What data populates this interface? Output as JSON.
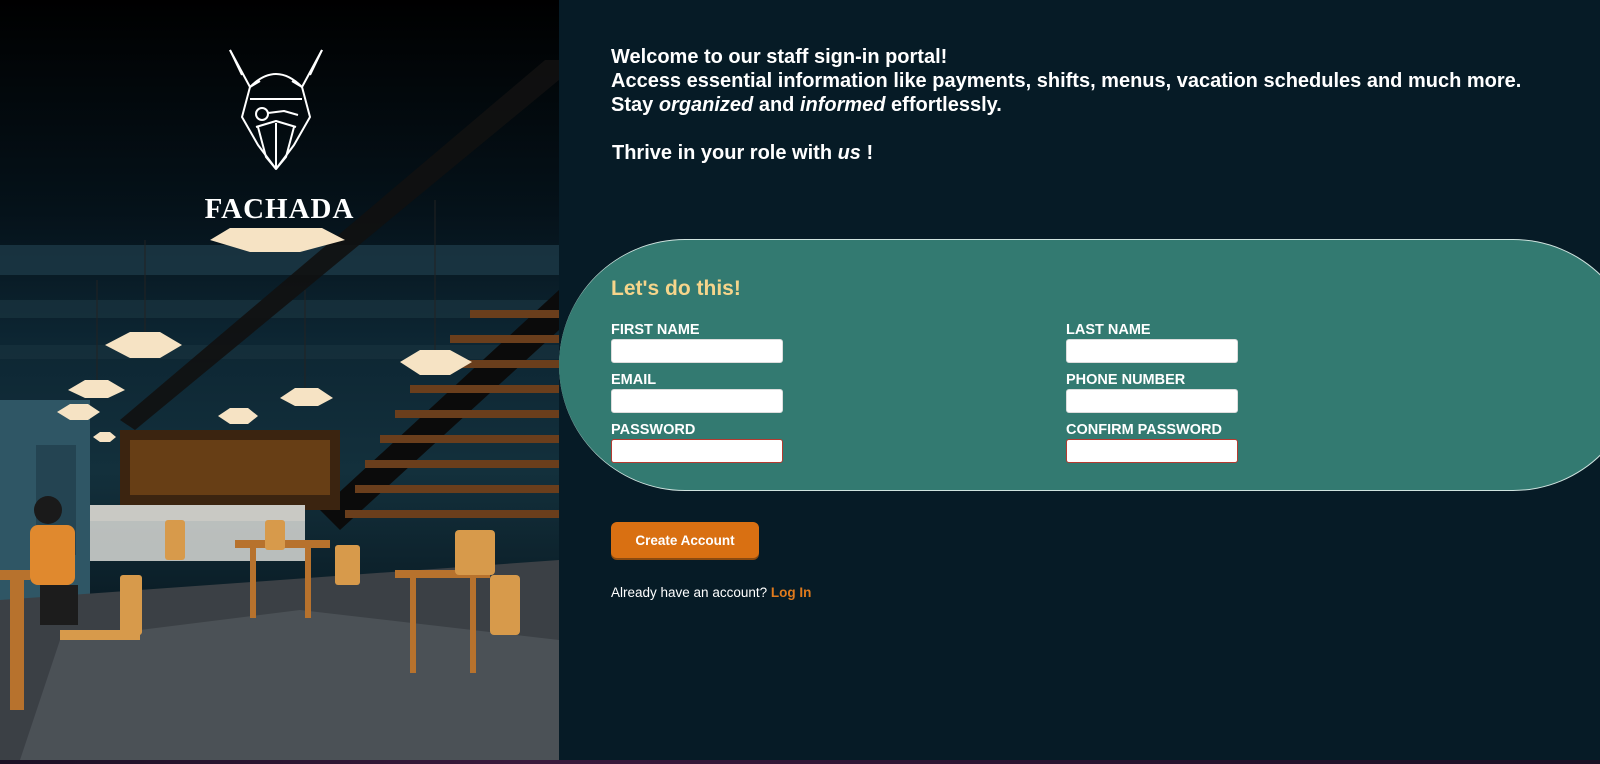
{
  "brand": {
    "name": "FACHADA"
  },
  "intro": {
    "line1": "Welcome to our staff sign-in portal!",
    "line2": "Access essential information like payments, shifts, menus, vacation schedules and much more.",
    "line3_a": "Stay ",
    "line3_b": "organized",
    "line3_c": " and ",
    "line3_d": "informed",
    "line3_e": " effortlessly.",
    "thrive_a": "Thrive in your role with ",
    "thrive_b": "us",
    "thrive_c": " !"
  },
  "form": {
    "title": "Let's do this!",
    "first_name": {
      "label": "FIRST NAME",
      "value": ""
    },
    "last_name": {
      "label": "LAST NAME",
      "value": ""
    },
    "email": {
      "label": "EMAIL",
      "value": ""
    },
    "phone": {
      "label": "PHONE NUMBER",
      "value": ""
    },
    "password": {
      "label": "PASSWORD",
      "value": ""
    },
    "confirm_password": {
      "label": "CONFIRM PASSWORD",
      "value": ""
    },
    "submit_label": "Create Account"
  },
  "login": {
    "prompt": "Already have an account? ",
    "link_label": "Log In"
  },
  "colors": {
    "background": "#061b26",
    "card": "#337a71",
    "accent": "#d97012",
    "title": "#f6d58b"
  }
}
